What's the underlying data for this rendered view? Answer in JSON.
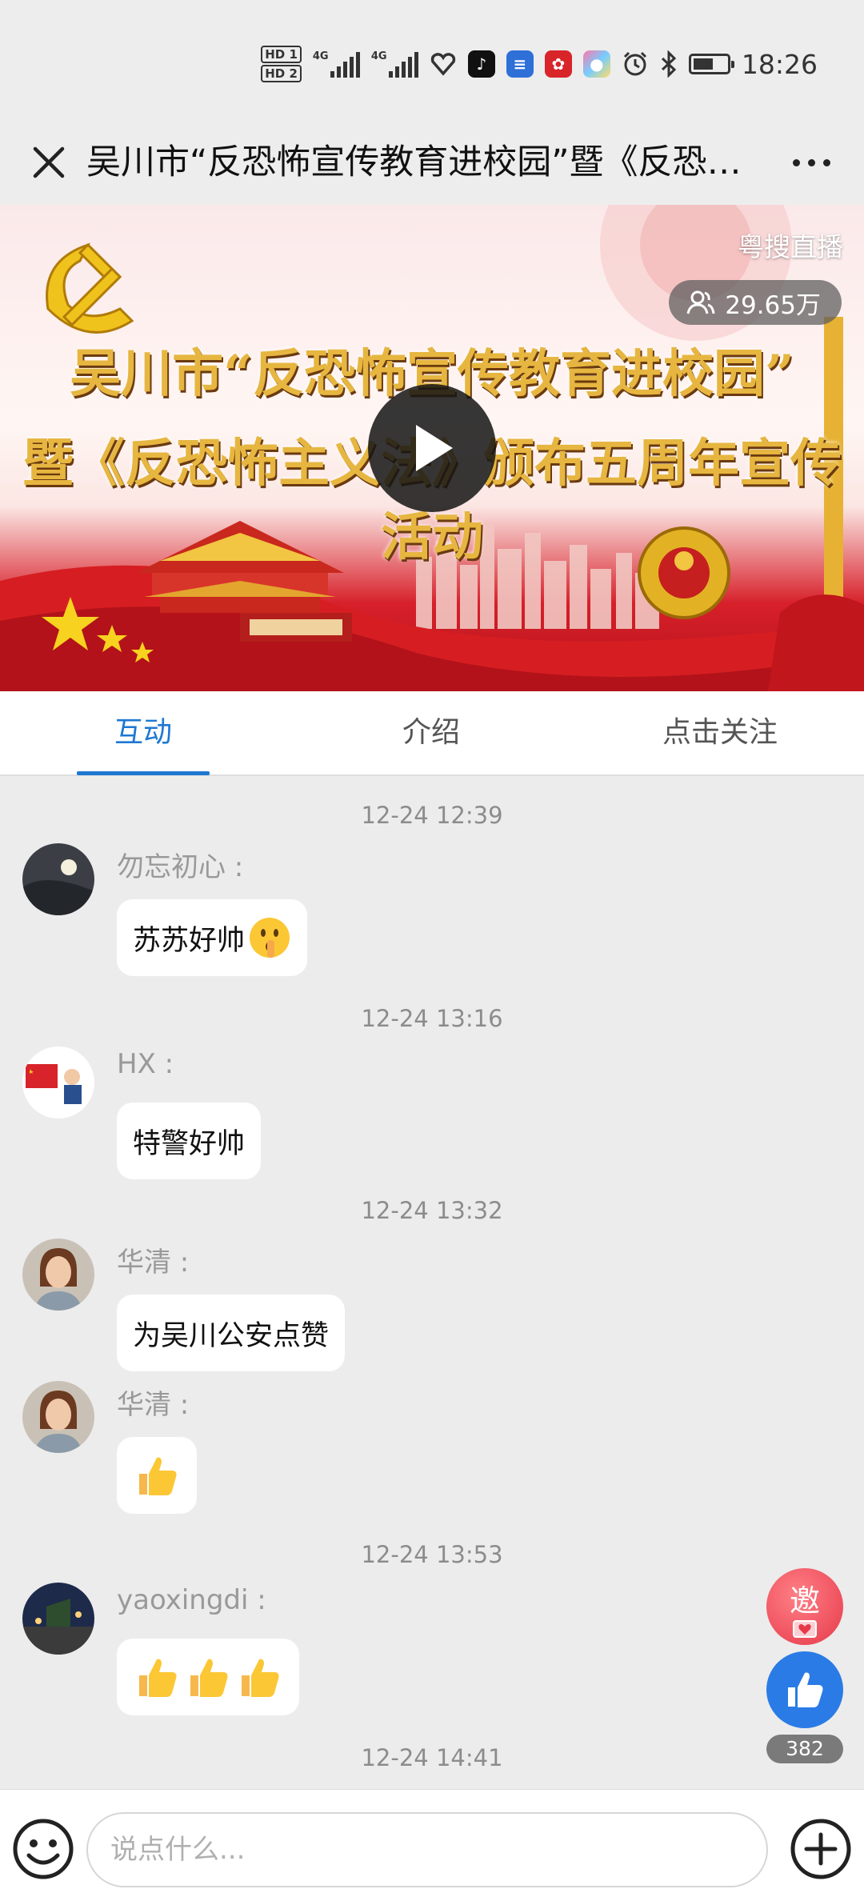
{
  "status_bar": {
    "hd1": "HD 1",
    "hd2": "HD 2",
    "network1": "4G",
    "network2": "4G",
    "time": "18:26"
  },
  "title_bar": {
    "title": "吴川市“反恐怖宣传教育进校园”暨《反恐怖主义法》颁布五周年宣传活动"
  },
  "video": {
    "headline_line1": "吴川市“反恐怖宣传教育进校园”",
    "headline_line2": "暨《反恐怖主义法》颁布五周年宣传活动",
    "source_label": "粤搜直播",
    "viewer_count": "29.65万"
  },
  "tabs": [
    {
      "label": "互动",
      "active": true
    },
    {
      "label": "介绍",
      "active": false
    },
    {
      "label": "点击关注",
      "active": false
    }
  ],
  "chat": {
    "timestamps": [
      "12-24 12:39",
      "12-24 13:16",
      "12-24 13:32",
      "12-24 13:53",
      "12-24 14:41"
    ],
    "messages": [
      {
        "user": "勿忘初心 :",
        "text": "苏苏好帅",
        "emoji": "shushing-face"
      },
      {
        "user": "HX :",
        "text": "特警好帅",
        "emoji": ""
      },
      {
        "user": "华清 :",
        "text": "为吴川公安点赞",
        "emoji": ""
      },
      {
        "user": "华清 :",
        "text": "",
        "emoji": "thumbs-up"
      },
      {
        "user": "yaoxingdi :",
        "text": "",
        "emoji": "thumbs-up x3"
      }
    ]
  },
  "floating": {
    "invite_label": "邀",
    "like_count": "382"
  },
  "input": {
    "placeholder": "说点什么..."
  },
  "colors": {
    "accent_blue": "#1e78d2",
    "like_blue": "#2a7be6",
    "invite_red": "#e63a4a",
    "banner_red": "#d7202a"
  }
}
